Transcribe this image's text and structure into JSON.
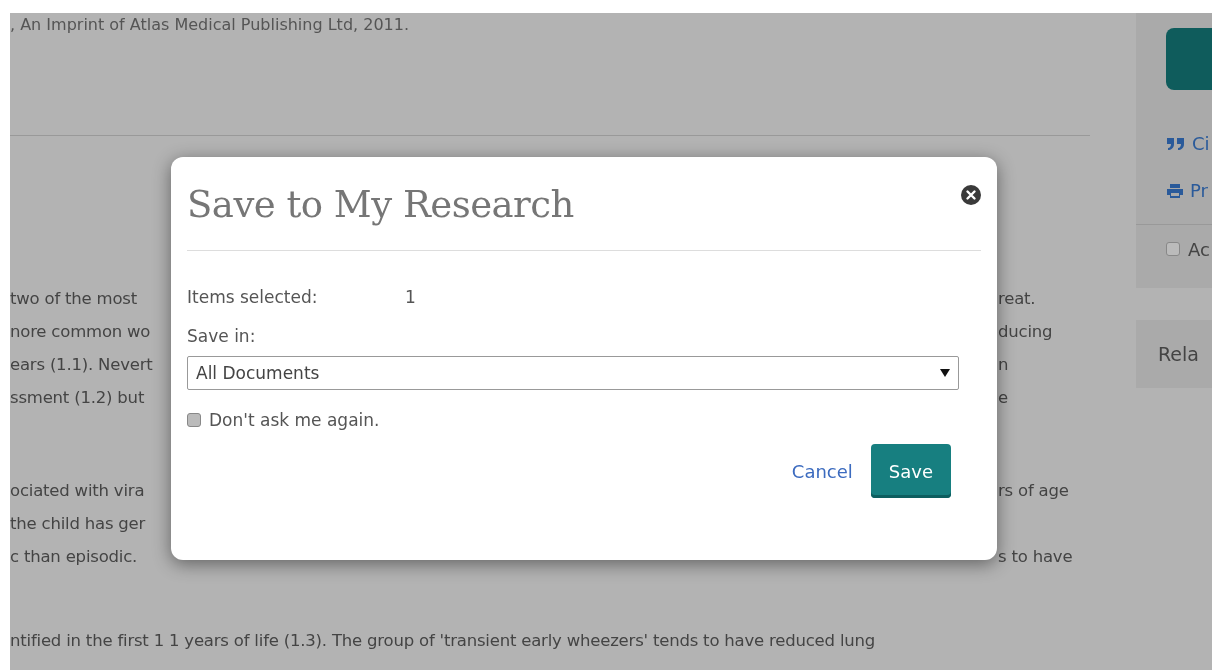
{
  "article": {
    "citation": ", An Imprint of Atlas Medical Publishing Ltd, 2011.",
    "paragraphs": [
      {
        "lines": [
          {
            "left": "two of the most",
            "right": "reat."
          },
          {
            "left": "nore common wo",
            "right": "ducing"
          },
          {
            "left": "ears (1.1). Nevert",
            "right": "n"
          },
          {
            "left": "ssment (1.2) but",
            "right": "e"
          }
        ]
      },
      {
        "lines": [
          {
            "left": "ociated with vira",
            "right": "rs of age"
          },
          {
            "left": "the child has ger"
          },
          {
            "left": "c than episodic.",
            "right": "s to have"
          }
        ]
      }
    ],
    "last_line": "ntified in the first 1 1 years of life (1.3). The group of 'transient early wheezers' tends to have reduced lung"
  },
  "sidebar": {
    "links": [
      {
        "kind": "cite",
        "label": "Ci"
      },
      {
        "kind": "print",
        "label": "Pr"
      }
    ],
    "checkbox": {
      "label": "Ac",
      "checked": false
    },
    "related_title": "Rela"
  },
  "dialog": {
    "title": "Save to My Research",
    "items_label": "Items selected:",
    "items_value": "1",
    "save_in_label": "Save in:",
    "save_in_value": "All Documents",
    "dont_ask": {
      "label": "Don't ask me again.",
      "checked": false
    },
    "buttons": [
      {
        "kind": "link",
        "label": "Cancel"
      },
      {
        "kind": "primary",
        "label": "Save"
      }
    ]
  }
}
